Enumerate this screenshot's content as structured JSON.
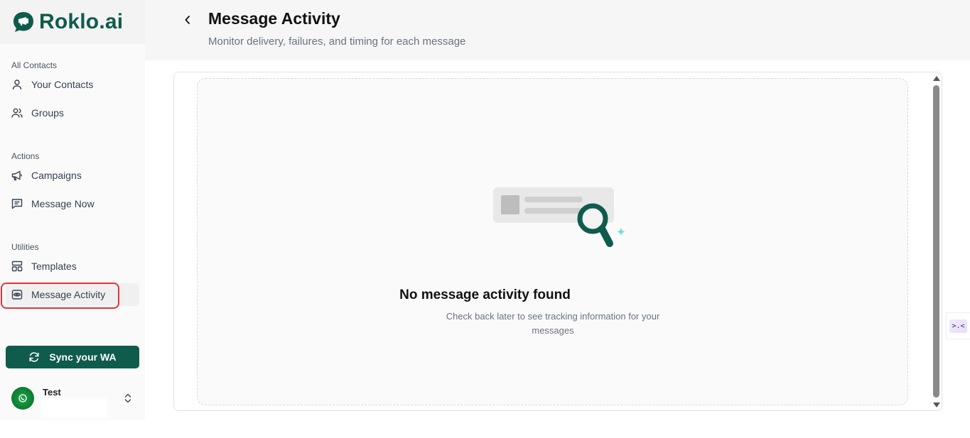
{
  "app": {
    "brand": "Roklo.ai",
    "brand_color": "#0f5b4c",
    "alert_outline_color": "#e0353b"
  },
  "sidebar": {
    "sections": [
      {
        "label": "All Contacts"
      },
      {
        "label": "Actions"
      },
      {
        "label": "Utilities"
      }
    ],
    "items": [
      {
        "label": "Your Contacts",
        "icon": "user-icon"
      },
      {
        "label": "Groups",
        "icon": "users-icon"
      },
      {
        "label": "Campaigns",
        "icon": "megaphone-icon"
      },
      {
        "label": "Message Now",
        "icon": "message-square-icon"
      },
      {
        "label": "Templates",
        "icon": "layout-template-icon"
      },
      {
        "label": "Message Activity",
        "icon": "activity-eye-icon",
        "active": true
      }
    ],
    "sync_button": "Sync your WA",
    "user": {
      "name": "Test"
    }
  },
  "header": {
    "title": "Message Activity",
    "subtitle": "Monitor delivery, failures, and timing for each message"
  },
  "empty_state": {
    "title": "No message activity found",
    "description": "Check back later to see tracking information for your messages"
  },
  "side_widget": {
    "text": ">.<"
  }
}
